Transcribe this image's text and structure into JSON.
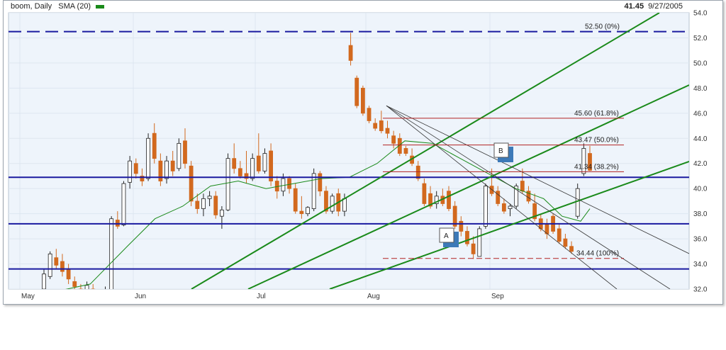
{
  "header": {
    "symbol_period": "boom, Daily",
    "indicator": "SMA (20)",
    "last_price": "41.45",
    "date": "9/27/2005"
  },
  "colors": {
    "background": "#eef4fb",
    "up_candle": "#ffffff",
    "down_candle": "#d2691e",
    "sma": "#1a8a1a",
    "support_lines": "#1a1aa0",
    "channel_lines": "#1a8a1a",
    "fib_lines": "#b22222",
    "fan_lines": "#333333"
  },
  "chart_data": {
    "type": "candlestick",
    "title": "",
    "xlabel": "",
    "ylabel": "",
    "ylim": [
      32.0,
      54.0
    ],
    "y_ticks": [
      "32.0",
      "34.0",
      "36.0",
      "38.0",
      "40.0",
      "42.0",
      "44.0",
      "46.0",
      "48.0",
      "50.0",
      "52.0",
      "54.0"
    ],
    "x_ticks": [
      "May",
      "Jun",
      "Jul",
      "Aug",
      "Sep"
    ],
    "grid": true,
    "candles": [
      {
        "date": "May-27",
        "o": 32.0,
        "h": 33.6,
        "l": 31.6,
        "c": 33.2
      },
      {
        "date": "May-31",
        "o": 33.0,
        "h": 35.0,
        "l": 32.8,
        "c": 34.8
      },
      {
        "date": "Jun-01",
        "o": 34.5,
        "h": 35.2,
        "l": 33.6,
        "c": 33.9
      },
      {
        "date": "Jun-02",
        "o": 34.2,
        "h": 34.8,
        "l": 33.0,
        "c": 33.4
      },
      {
        "date": "Jun-03",
        "o": 33.6,
        "h": 34.0,
        "l": 32.4,
        "c": 32.8
      },
      {
        "date": "Jun-06",
        "o": 32.6,
        "h": 33.0,
        "l": 31.8,
        "c": 32.2
      },
      {
        "date": "Jun-07",
        "o": 32.0,
        "h": 32.4,
        "l": 31.4,
        "c": 31.7
      },
      {
        "date": "Jun-08",
        "o": 31.8,
        "h": 32.6,
        "l": 31.6,
        "c": 32.3
      },
      {
        "date": "Jun-09",
        "o": 32.0,
        "h": 32.4,
        "l": 31.2,
        "c": 31.6
      },
      {
        "date": "Jun-10",
        "o": 31.4,
        "h": 32.0,
        "l": 31.0,
        "c": 31.9
      },
      {
        "date": "Jun-13",
        "o": 31.5,
        "h": 32.2,
        "l": 31.0,
        "c": 31.8
      },
      {
        "date": "Jun-14",
        "o": 31.6,
        "h": 37.8,
        "l": 31.5,
        "c": 37.6
      },
      {
        "date": "Jun-15",
        "o": 37.5,
        "h": 38.2,
        "l": 36.8,
        "c": 37.0
      },
      {
        "date": "Jun-16",
        "o": 37.1,
        "h": 40.6,
        "l": 37.0,
        "c": 40.4
      },
      {
        "date": "Jun-17",
        "o": 40.5,
        "h": 42.6,
        "l": 40.0,
        "c": 42.2
      },
      {
        "date": "Jun-20",
        "o": 42.0,
        "h": 42.4,
        "l": 40.8,
        "c": 41.2
      },
      {
        "date": "Jun-21",
        "o": 41.0,
        "h": 41.6,
        "l": 40.2,
        "c": 40.6
      },
      {
        "date": "Jun-22",
        "o": 40.8,
        "h": 44.4,
        "l": 40.6,
        "c": 44.0
      },
      {
        "date": "Jun-23",
        "o": 44.4,
        "h": 45.2,
        "l": 42.0,
        "c": 42.4
      },
      {
        "date": "Jun-24",
        "o": 42.2,
        "h": 42.8,
        "l": 40.2,
        "c": 40.6
      },
      {
        "date": "Jun-27",
        "o": 40.8,
        "h": 42.6,
        "l": 40.4,
        "c": 42.2
      },
      {
        "date": "Jun-28",
        "o": 42.2,
        "h": 43.0,
        "l": 41.0,
        "c": 41.4
      },
      {
        "date": "Jun-29",
        "o": 41.6,
        "h": 44.0,
        "l": 41.4,
        "c": 43.6
      },
      {
        "date": "Jun-30",
        "o": 43.8,
        "h": 44.8,
        "l": 41.6,
        "c": 42.0
      },
      {
        "date": "Jul-01",
        "o": 41.8,
        "h": 42.2,
        "l": 38.6,
        "c": 39.0
      },
      {
        "date": "Jul-05",
        "o": 39.0,
        "h": 39.6,
        "l": 38.0,
        "c": 38.4
      },
      {
        "date": "Jul-06",
        "o": 38.4,
        "h": 39.6,
        "l": 37.8,
        "c": 39.2
      },
      {
        "date": "Jul-07",
        "o": 39.2,
        "h": 39.8,
        "l": 38.6,
        "c": 39.4
      },
      {
        "date": "Jul-08",
        "o": 39.4,
        "h": 39.8,
        "l": 37.6,
        "c": 37.9
      },
      {
        "date": "Jul-11",
        "o": 37.8,
        "h": 38.6,
        "l": 36.8,
        "c": 38.3
      },
      {
        "date": "Jul-12",
        "o": 38.3,
        "h": 42.8,
        "l": 38.2,
        "c": 42.4
      },
      {
        "date": "Jul-13",
        "o": 42.4,
        "h": 43.6,
        "l": 41.2,
        "c": 41.6
      },
      {
        "date": "Jul-14",
        "o": 41.6,
        "h": 42.2,
        "l": 40.8,
        "c": 41.0
      },
      {
        "date": "Jul-15",
        "o": 41.2,
        "h": 43.0,
        "l": 40.4,
        "c": 40.8
      },
      {
        "date": "Jul-18",
        "o": 40.8,
        "h": 42.8,
        "l": 40.6,
        "c": 42.4
      },
      {
        "date": "Jul-19",
        "o": 42.6,
        "h": 44.4,
        "l": 41.2,
        "c": 41.4
      },
      {
        "date": "Jul-20",
        "o": 41.4,
        "h": 43.2,
        "l": 41.2,
        "c": 42.8
      },
      {
        "date": "Jul-21",
        "o": 43.0,
        "h": 43.6,
        "l": 40.2,
        "c": 40.6
      },
      {
        "date": "Jul-22",
        "o": 40.6,
        "h": 41.0,
        "l": 39.2,
        "c": 39.8
      },
      {
        "date": "Jul-25",
        "o": 39.8,
        "h": 41.2,
        "l": 39.4,
        "c": 40.8
      },
      {
        "date": "Jul-26",
        "o": 40.8,
        "h": 41.0,
        "l": 39.6,
        "c": 40.0
      },
      {
        "date": "Jul-27",
        "o": 40.0,
        "h": 40.4,
        "l": 38.0,
        "c": 38.2
      },
      {
        "date": "Jul-28",
        "o": 38.2,
        "h": 39.4,
        "l": 37.6,
        "c": 38.0
      },
      {
        "date": "Jul-29",
        "o": 38.0,
        "h": 38.6,
        "l": 37.8,
        "c": 38.5
      },
      {
        "date": "Aug-01",
        "o": 38.4,
        "h": 41.6,
        "l": 38.2,
        "c": 41.2
      },
      {
        "date": "Aug-02",
        "o": 41.2,
        "h": 41.4,
        "l": 39.4,
        "c": 39.8
      },
      {
        "date": "Aug-03",
        "o": 39.8,
        "h": 40.2,
        "l": 38.0,
        "c": 38.2
      },
      {
        "date": "Aug-04",
        "o": 38.2,
        "h": 39.6,
        "l": 38.0,
        "c": 39.4
      },
      {
        "date": "Aug-05",
        "o": 39.6,
        "h": 40.0,
        "l": 37.8,
        "c": 38.2
      },
      {
        "date": "Aug-08",
        "o": 38.2,
        "h": 39.6,
        "l": 37.8,
        "c": 39.2
      },
      {
        "date": "Aug-09",
        "o": 39.2,
        "h": 39.6,
        "l": 38.4,
        "c": 39.4
      },
      {
        "date": "Aug-10",
        "o": 39.6,
        "h": 42.8,
        "l": 39.4,
        "c": 42.4
      },
      {
        "date": "Aug-11",
        "o": 42.6,
        "h": 43.2,
        "l": 39.4,
        "c": 39.6
      },
      {
        "date": "Aug-12",
        "o": 39.6,
        "h": 40.4,
        "l": 38.8,
        "c": 40.0
      },
      {
        "date": "Aug-15",
        "o": 40.2,
        "h": 46.2,
        "l": 40.0,
        "c": 40.6
      },
      {
        "date": "Aug-16",
        "o": 40.6,
        "h": 41.6,
        "l": 39.8,
        "c": 40.2
      },
      {
        "date": "Aug-17",
        "o": 40.2,
        "h": 41.4,
        "l": 39.6,
        "c": 39.8
      },
      {
        "date": "Aug-18",
        "o": 39.8,
        "h": 40.4,
        "l": 39.0,
        "c": 39.6
      },
      {
        "date": "Aug-19",
        "o": 39.6,
        "h": 40.2,
        "l": 39.0,
        "c": 40.0
      },
      {
        "date": "Aug-22",
        "o": 40.2,
        "h": 41.4,
        "l": 40.0,
        "c": 41.2
      },
      {
        "date": "Aug-23",
        "o": 41.2,
        "h": 42.6,
        "l": 40.6,
        "c": 40.8
      },
      {
        "date": "Aug-24",
        "o": 40.8,
        "h": 42.2,
        "l": 40.6,
        "c": 41.8
      },
      {
        "date": "Aug-25",
        "o": 41.8,
        "h": 42.2,
        "l": 40.6,
        "c": 41.0
      },
      {
        "date": "Aug-26",
        "o": 41.0,
        "h": 41.6,
        "l": 40.4,
        "c": 40.8
      },
      {
        "date": "Aug-29",
        "o": 40.6,
        "h": 41.2,
        "l": 40.2,
        "c": 41.0
      },
      {
        "date": "Aug-30",
        "o": 41.0,
        "h": 41.4,
        "l": 40.4,
        "c": 40.6
      },
      {
        "date": "Aug-31",
        "o": 40.6,
        "h": 41.2,
        "l": 40.2,
        "c": 40.8
      },
      {
        "date": "Sep-01",
        "o": 40.8,
        "h": 41.6,
        "l": 40.4,
        "c": 41.2
      },
      {
        "date": "Sep-02",
        "o": 41.2,
        "h": 41.4,
        "l": 40.4,
        "c": 40.6
      },
      {
        "date": "Sep-05",
        "o": 40.6,
        "h": 41.4,
        "l": 40.2,
        "c": 41.0
      },
      {
        "date": "Sep-06",
        "o": 40.8,
        "h": 43.4,
        "l": 40.6,
        "c": 43.2
      },
      {
        "date": "Sep-07",
        "o": 43.6,
        "h": 44.2,
        "l": 42.4,
        "c": 42.6
      },
      {
        "date": "Sep-08",
        "o": 42.8,
        "h": 46.4,
        "l": 42.2,
        "c": 46.0
      },
      {
        "date": "Sep-09",
        "o": 46.2,
        "h": 47.2,
        "l": 43.6,
        "c": 44.0
      }
    ],
    "candles_note": "",
    "aug_sep_candles": [
      {
        "o": 51.4,
        "h": 52.4,
        "l": 49.8,
        "c": 50.2
      },
      {
        "o": 48.8,
        "h": 49.0,
        "l": 46.4,
        "c": 46.6
      },
      {
        "o": 48.0,
        "h": 48.2,
        "l": 45.8,
        "c": 46.0
      },
      {
        "o": 46.4,
        "h": 46.6,
        "l": 45.2,
        "c": 45.4
      },
      {
        "o": 45.2,
        "h": 45.6,
        "l": 44.6,
        "c": 44.8
      },
      {
        "o": 45.4,
        "h": 46.2,
        "l": 44.4,
        "c": 44.6
      },
      {
        "o": 44.8,
        "h": 45.4,
        "l": 44.0,
        "c": 44.4
      },
      {
        "o": 44.2,
        "h": 44.6,
        "l": 43.2,
        "c": 43.6
      },
      {
        "o": 44.0,
        "h": 44.4,
        "l": 42.6,
        "c": 42.8
      },
      {
        "o": 43.2,
        "h": 43.4,
        "l": 42.6,
        "c": 42.8
      },
      {
        "o": 42.6,
        "h": 43.2,
        "l": 41.8,
        "c": 42.0
      },
      {
        "o": 41.8,
        "h": 42.2,
        "l": 40.6,
        "c": 40.8
      },
      {
        "o": 40.4,
        "h": 40.8,
        "l": 38.6,
        "c": 38.8
      },
      {
        "o": 39.6,
        "h": 40.2,
        "l": 38.4,
        "c": 38.6
      },
      {
        "o": 38.8,
        "h": 39.8,
        "l": 38.4,
        "c": 39.4
      },
      {
        "o": 39.4,
        "h": 40.0,
        "l": 38.6,
        "c": 38.8
      },
      {
        "o": 39.8,
        "h": 40.2,
        "l": 38.2,
        "c": 38.4
      },
      {
        "o": 38.6,
        "h": 39.0,
        "l": 36.8,
        "c": 37.0
      },
      {
        "o": 37.4,
        "h": 37.8,
        "l": 36.2,
        "c": 36.6
      },
      {
        "o": 36.6,
        "h": 37.0,
        "l": 35.4,
        "c": 35.6
      },
      {
        "o": 35.6,
        "h": 36.2,
        "l": 34.4,
        "c": 34.8
      },
      {
        "o": 34.6,
        "h": 37.0,
        "l": 34.6,
        "c": 36.8
      },
      {
        "o": 37.0,
        "h": 40.4,
        "l": 36.8,
        "c": 40.2
      },
      {
        "o": 40.2,
        "h": 41.6,
        "l": 39.4,
        "c": 39.6
      },
      {
        "o": 39.8,
        "h": 40.2,
        "l": 38.6,
        "c": 38.8
      },
      {
        "o": 38.8,
        "h": 39.2,
        "l": 38.0,
        "c": 38.2
      },
      {
        "o": 38.4,
        "h": 38.8,
        "l": 37.8,
        "c": 38.6
      },
      {
        "o": 38.6,
        "h": 40.4,
        "l": 38.4,
        "c": 40.2
      },
      {
        "o": 40.6,
        "h": 41.6,
        "l": 39.6,
        "c": 39.8
      },
      {
        "o": 39.8,
        "h": 40.2,
        "l": 38.8,
        "c": 39.0
      },
      {
        "o": 38.8,
        "h": 39.6,
        "l": 37.4,
        "c": 37.6
      },
      {
        "o": 37.6,
        "h": 38.0,
        "l": 36.6,
        "c": 36.8
      },
      {
        "o": 37.2,
        "h": 37.6,
        "l": 36.0,
        "c": 36.4
      },
      {
        "o": 37.8,
        "h": 38.0,
        "l": 36.4,
        "c": 36.6
      },
      {
        "o": 36.8,
        "h": 37.2,
        "l": 35.6,
        "c": 35.8
      },
      {
        "o": 36.0,
        "h": 36.4,
        "l": 35.2,
        "c": 35.4
      },
      {
        "o": 35.4,
        "h": 35.8,
        "l": 34.8,
        "c": 35.0
      },
      {
        "o": 37.8,
        "h": 40.4,
        "l": 37.6,
        "c": 40.0
      },
      {
        "o": 41.2,
        "h": 43.6,
        "l": 41.0,
        "c": 43.2
      },
      {
        "o": 42.8,
        "h": 43.4,
        "l": 41.4,
        "c": 41.45
      }
    ],
    "sma": [
      {
        "i": 0,
        "v": 31.6
      },
      {
        "i": 10,
        "v": 32.4
      },
      {
        "i": 18,
        "v": 35.4
      },
      {
        "i": 24,
        "v": 37.6
      },
      {
        "i": 30,
        "v": 38.6
      },
      {
        "i": 36,
        "v": 40.2
      },
      {
        "i": 42,
        "v": 40.6
      },
      {
        "i": 48,
        "v": 40.0
      },
      {
        "i": 54,
        "v": 40.4
      },
      {
        "i": 60,
        "v": 40.8
      },
      {
        "i": 66,
        "v": 40.9
      },
      {
        "i": 72,
        "v": 42.0
      },
      {
        "i": 78,
        "v": 43.8
      },
      {
        "i": 84,
        "v": 43.6
      },
      {
        "i": 90,
        "v": 42.4
      },
      {
        "i": 96,
        "v": 41.2
      },
      {
        "i": 102,
        "v": 40.0
      },
      {
        "i": 108,
        "v": 39.2
      },
      {
        "i": 112,
        "v": 37.8
      },
      {
        "i": 116,
        "v": 37.4
      },
      {
        "i": 118,
        "v": 38.4
      }
    ],
    "horizontal_lines": [
      {
        "value": 52.5,
        "style": "dashed"
      },
      {
        "value": 40.9,
        "style": "solid"
      },
      {
        "value": 37.2,
        "style": "solid"
      },
      {
        "value": 33.6,
        "style": "solid"
      }
    ],
    "fib_levels": [
      {
        "value": 52.5,
        "label": "52.50 (0%)"
      },
      {
        "value": 45.6,
        "label": "45.60 (61.8%)"
      },
      {
        "value": 43.47,
        "label": "43.47 (50.0%)"
      },
      {
        "value": 41.34,
        "label": "41.34 (38.2%)"
      },
      {
        "value": 34.44,
        "label": "34.44 (100%)"
      }
    ],
    "markers": [
      "A",
      "B"
    ]
  }
}
